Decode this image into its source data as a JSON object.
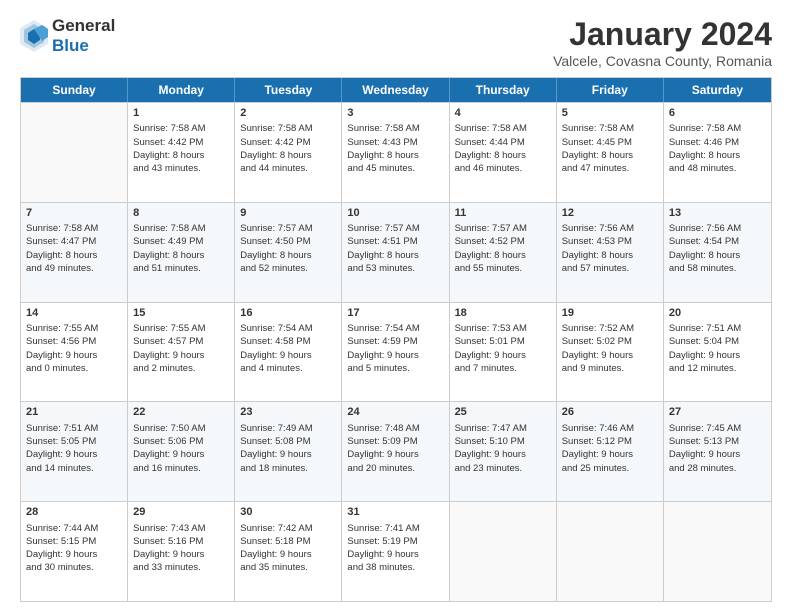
{
  "header": {
    "logo_general": "General",
    "logo_blue": "Blue",
    "month_title": "January 2024",
    "location": "Valcele, Covasna County, Romania"
  },
  "weekdays": [
    "Sunday",
    "Monday",
    "Tuesday",
    "Wednesday",
    "Thursday",
    "Friday",
    "Saturday"
  ],
  "rows": [
    [
      {
        "day": "",
        "empty": true
      },
      {
        "day": "1",
        "lines": [
          "Sunrise: 7:58 AM",
          "Sunset: 4:42 PM",
          "Daylight: 8 hours",
          "and 43 minutes."
        ]
      },
      {
        "day": "2",
        "lines": [
          "Sunrise: 7:58 AM",
          "Sunset: 4:42 PM",
          "Daylight: 8 hours",
          "and 44 minutes."
        ]
      },
      {
        "day": "3",
        "lines": [
          "Sunrise: 7:58 AM",
          "Sunset: 4:43 PM",
          "Daylight: 8 hours",
          "and 45 minutes."
        ]
      },
      {
        "day": "4",
        "lines": [
          "Sunrise: 7:58 AM",
          "Sunset: 4:44 PM",
          "Daylight: 8 hours",
          "and 46 minutes."
        ]
      },
      {
        "day": "5",
        "lines": [
          "Sunrise: 7:58 AM",
          "Sunset: 4:45 PM",
          "Daylight: 8 hours",
          "and 47 minutes."
        ]
      },
      {
        "day": "6",
        "lines": [
          "Sunrise: 7:58 AM",
          "Sunset: 4:46 PM",
          "Daylight: 8 hours",
          "and 48 minutes."
        ]
      }
    ],
    [
      {
        "day": "7",
        "lines": [
          "Sunrise: 7:58 AM",
          "Sunset: 4:47 PM",
          "Daylight: 8 hours",
          "and 49 minutes."
        ]
      },
      {
        "day": "8",
        "lines": [
          "Sunrise: 7:58 AM",
          "Sunset: 4:49 PM",
          "Daylight: 8 hours",
          "and 51 minutes."
        ]
      },
      {
        "day": "9",
        "lines": [
          "Sunrise: 7:57 AM",
          "Sunset: 4:50 PM",
          "Daylight: 8 hours",
          "and 52 minutes."
        ]
      },
      {
        "day": "10",
        "lines": [
          "Sunrise: 7:57 AM",
          "Sunset: 4:51 PM",
          "Daylight: 8 hours",
          "and 53 minutes."
        ]
      },
      {
        "day": "11",
        "lines": [
          "Sunrise: 7:57 AM",
          "Sunset: 4:52 PM",
          "Daylight: 8 hours",
          "and 55 minutes."
        ]
      },
      {
        "day": "12",
        "lines": [
          "Sunrise: 7:56 AM",
          "Sunset: 4:53 PM",
          "Daylight: 8 hours",
          "and 57 minutes."
        ]
      },
      {
        "day": "13",
        "lines": [
          "Sunrise: 7:56 AM",
          "Sunset: 4:54 PM",
          "Daylight: 8 hours",
          "and 58 minutes."
        ]
      }
    ],
    [
      {
        "day": "14",
        "lines": [
          "Sunrise: 7:55 AM",
          "Sunset: 4:56 PM",
          "Daylight: 9 hours",
          "and 0 minutes."
        ]
      },
      {
        "day": "15",
        "lines": [
          "Sunrise: 7:55 AM",
          "Sunset: 4:57 PM",
          "Daylight: 9 hours",
          "and 2 minutes."
        ]
      },
      {
        "day": "16",
        "lines": [
          "Sunrise: 7:54 AM",
          "Sunset: 4:58 PM",
          "Daylight: 9 hours",
          "and 4 minutes."
        ]
      },
      {
        "day": "17",
        "lines": [
          "Sunrise: 7:54 AM",
          "Sunset: 4:59 PM",
          "Daylight: 9 hours",
          "and 5 minutes."
        ]
      },
      {
        "day": "18",
        "lines": [
          "Sunrise: 7:53 AM",
          "Sunset: 5:01 PM",
          "Daylight: 9 hours",
          "and 7 minutes."
        ]
      },
      {
        "day": "19",
        "lines": [
          "Sunrise: 7:52 AM",
          "Sunset: 5:02 PM",
          "Daylight: 9 hours",
          "and 9 minutes."
        ]
      },
      {
        "day": "20",
        "lines": [
          "Sunrise: 7:51 AM",
          "Sunset: 5:04 PM",
          "Daylight: 9 hours",
          "and 12 minutes."
        ]
      }
    ],
    [
      {
        "day": "21",
        "lines": [
          "Sunrise: 7:51 AM",
          "Sunset: 5:05 PM",
          "Daylight: 9 hours",
          "and 14 minutes."
        ]
      },
      {
        "day": "22",
        "lines": [
          "Sunrise: 7:50 AM",
          "Sunset: 5:06 PM",
          "Daylight: 9 hours",
          "and 16 minutes."
        ]
      },
      {
        "day": "23",
        "lines": [
          "Sunrise: 7:49 AM",
          "Sunset: 5:08 PM",
          "Daylight: 9 hours",
          "and 18 minutes."
        ]
      },
      {
        "day": "24",
        "lines": [
          "Sunrise: 7:48 AM",
          "Sunset: 5:09 PM",
          "Daylight: 9 hours",
          "and 20 minutes."
        ]
      },
      {
        "day": "25",
        "lines": [
          "Sunrise: 7:47 AM",
          "Sunset: 5:10 PM",
          "Daylight: 9 hours",
          "and 23 minutes."
        ]
      },
      {
        "day": "26",
        "lines": [
          "Sunrise: 7:46 AM",
          "Sunset: 5:12 PM",
          "Daylight: 9 hours",
          "and 25 minutes."
        ]
      },
      {
        "day": "27",
        "lines": [
          "Sunrise: 7:45 AM",
          "Sunset: 5:13 PM",
          "Daylight: 9 hours",
          "and 28 minutes."
        ]
      }
    ],
    [
      {
        "day": "28",
        "lines": [
          "Sunrise: 7:44 AM",
          "Sunset: 5:15 PM",
          "Daylight: 9 hours",
          "and 30 minutes."
        ]
      },
      {
        "day": "29",
        "lines": [
          "Sunrise: 7:43 AM",
          "Sunset: 5:16 PM",
          "Daylight: 9 hours",
          "and 33 minutes."
        ]
      },
      {
        "day": "30",
        "lines": [
          "Sunrise: 7:42 AM",
          "Sunset: 5:18 PM",
          "Daylight: 9 hours",
          "and 35 minutes."
        ]
      },
      {
        "day": "31",
        "lines": [
          "Sunrise: 7:41 AM",
          "Sunset: 5:19 PM",
          "Daylight: 9 hours",
          "and 38 minutes."
        ]
      },
      {
        "day": "",
        "empty": true
      },
      {
        "day": "",
        "empty": true
      },
      {
        "day": "",
        "empty": true
      }
    ]
  ]
}
